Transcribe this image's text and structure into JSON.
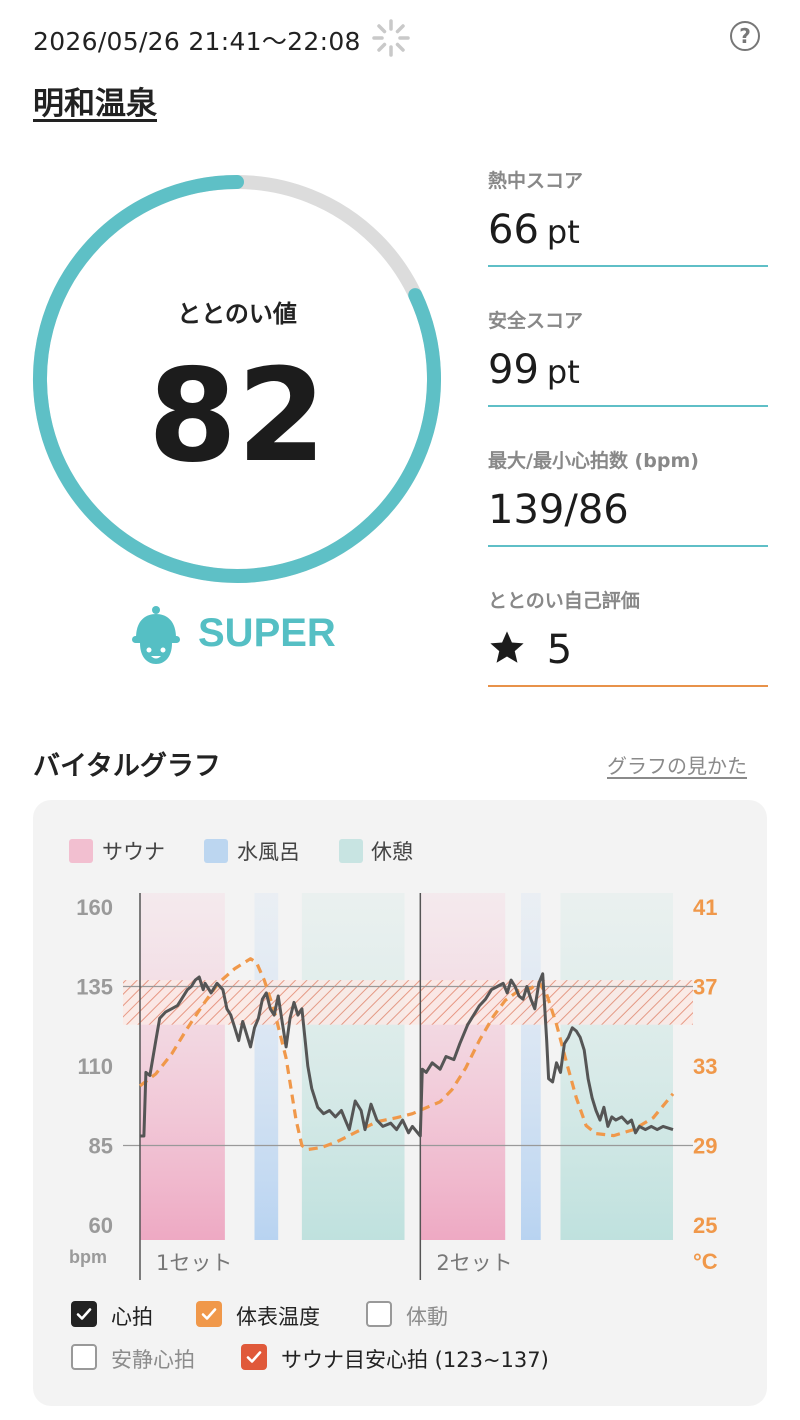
{
  "header": {
    "datetime": "2026/05/26 21:41～22:08",
    "place": "明和温泉",
    "help_symbol": "?",
    "spinner_icon": "loading-spinner-icon"
  },
  "gauge": {
    "label": "ととのい値",
    "value": "82",
    "fraction": 0.82,
    "color": "#5ec0c6",
    "track_color": "#dcdcdc",
    "level": "SUPER",
    "level_icon": "sauna-hat-mascot-icon"
  },
  "stats": [
    {
      "label": "熱中スコア",
      "value": "66",
      "unit": "pt"
    },
    {
      "label": "安全スコア",
      "value": "99",
      "unit": "pt"
    },
    {
      "label": "最大/最小心拍数 (bpm)",
      "value": "139/86",
      "unit": ""
    },
    {
      "label": "ととのい自己評価",
      "value": "5",
      "unit": "",
      "icon": "star-icon"
    }
  ],
  "vital": {
    "title": "バイタルグラフ",
    "howto_link": "グラフの見かた",
    "legend": [
      {
        "label": "サウナ",
        "color": "#f2bfd0"
      },
      {
        "label": "水風呂",
        "color": "#bcd6f0"
      },
      {
        "label": "休憩",
        "color": "#c8e4e2"
      }
    ],
    "left_axis_unit": "bpm",
    "right_axis_unit": "°C",
    "checkboxes": [
      {
        "label": "心拍",
        "checked": true,
        "color": "#222222"
      },
      {
        "label": "体表温度",
        "checked": true,
        "color": "#f0984a"
      },
      {
        "label": "体動",
        "checked": false,
        "color": "#888888"
      },
      {
        "label": "安静心拍",
        "checked": false,
        "color": "#888888"
      },
      {
        "label": "サウナ目安心拍 (123~137)",
        "checked": true,
        "color": "#e0593a"
      }
    ]
  },
  "chart_data": {
    "type": "line",
    "y_left_ticks": [
      "160",
      "135",
      "110",
      "85",
      "60"
    ],
    "y_left_range": [
      60,
      160
    ],
    "y_right_ticks": [
      "41",
      "37",
      "33",
      "29",
      "25"
    ],
    "y_right_range": [
      25,
      41
    ],
    "set_labels": [
      "1セット",
      "2セット"
    ],
    "target_band": [
      123,
      137
    ],
    "reference_line": 135,
    "baseline": 85,
    "time_range_min": [
      0,
      27
    ],
    "phases": [
      {
        "type": "サウナ",
        "start": 0.0,
        "end": 4.3
      },
      {
        "type": "水風呂",
        "start": 5.8,
        "end": 7.0
      },
      {
        "type": "休憩",
        "start": 8.2,
        "end": 13.4
      },
      {
        "type": "サウナ",
        "start": 14.2,
        "end": 18.5
      },
      {
        "type": "水風呂",
        "start": 19.3,
        "end": 20.3
      },
      {
        "type": "休憩",
        "start": 21.3,
        "end": 27.0
      }
    ],
    "series": [
      {
        "name": "心拍",
        "color": "#555555",
        "points": [
          [
            0,
            88
          ],
          [
            0.2,
            88
          ],
          [
            0.3,
            108
          ],
          [
            0.5,
            107
          ],
          [
            0.8,
            118
          ],
          [
            1.0,
            125
          ],
          [
            1.3,
            127
          ],
          [
            1.6,
            128
          ],
          [
            1.9,
            129
          ],
          [
            2.1,
            131
          ],
          [
            2.4,
            134
          ],
          [
            2.6,
            135
          ],
          [
            2.8,
            137
          ],
          [
            3.0,
            138
          ],
          [
            3.2,
            134
          ],
          [
            3.3,
            136
          ],
          [
            3.6,
            133
          ],
          [
            3.9,
            136
          ],
          [
            4.2,
            134
          ],
          [
            4.4,
            128
          ],
          [
            4.6,
            126
          ],
          [
            4.8,
            122
          ],
          [
            5.0,
            118
          ],
          [
            5.2,
            124
          ],
          [
            5.4,
            120
          ],
          [
            5.6,
            116
          ],
          [
            5.8,
            122
          ],
          [
            6.0,
            125
          ],
          [
            6.2,
            131
          ],
          [
            6.4,
            133
          ],
          [
            6.6,
            128
          ],
          [
            6.8,
            126
          ],
          [
            7.0,
            132
          ],
          [
            7.2,
            124
          ],
          [
            7.4,
            116
          ],
          [
            7.6,
            125
          ],
          [
            7.8,
            130
          ],
          [
            8.0,
            126
          ],
          [
            8.2,
            128
          ],
          [
            8.5,
            110
          ],
          [
            8.7,
            103
          ],
          [
            9.0,
            97
          ],
          [
            9.3,
            95
          ],
          [
            9.6,
            96
          ],
          [
            9.9,
            94
          ],
          [
            10.2,
            96
          ],
          [
            10.4,
            93
          ],
          [
            10.6,
            90
          ],
          [
            10.9,
            99
          ],
          [
            11.2,
            96
          ],
          [
            11.4,
            90
          ],
          [
            11.7,
            98
          ],
          [
            12.0,
            93
          ],
          [
            12.3,
            91
          ],
          [
            12.7,
            92
          ],
          [
            13.0,
            90
          ],
          [
            13.3,
            93
          ],
          [
            13.6,
            89
          ],
          [
            13.8,
            91
          ],
          [
            14.2,
            88
          ],
          [
            14.3,
            109
          ],
          [
            14.5,
            108
          ],
          [
            14.8,
            111
          ],
          [
            15.2,
            109
          ],
          [
            15.5,
            113
          ],
          [
            15.9,
            112
          ],
          [
            16.2,
            117
          ],
          [
            16.6,
            123
          ],
          [
            16.9,
            126
          ],
          [
            17.2,
            129
          ],
          [
            17.5,
            131
          ],
          [
            17.8,
            134
          ],
          [
            18.1,
            135
          ],
          [
            18.4,
            136
          ],
          [
            18.6,
            133
          ],
          [
            18.8,
            137
          ],
          [
            19.0,
            135
          ],
          [
            19.2,
            132
          ],
          [
            19.4,
            131
          ],
          [
            19.6,
            135
          ],
          [
            19.8,
            131
          ],
          [
            20.0,
            128
          ],
          [
            20.2,
            136
          ],
          [
            20.4,
            139
          ],
          [
            20.6,
            118
          ],
          [
            20.7,
            106
          ],
          [
            20.9,
            105
          ],
          [
            21.1,
            111
          ],
          [
            21.3,
            108
          ],
          [
            21.5,
            117
          ],
          [
            21.7,
            119
          ],
          [
            21.9,
            122
          ],
          [
            22.1,
            121
          ],
          [
            22.3,
            119
          ],
          [
            22.5,
            115
          ],
          [
            22.7,
            106
          ],
          [
            22.9,
            100
          ],
          [
            23.1,
            96
          ],
          [
            23.3,
            93
          ],
          [
            23.5,
            97
          ],
          [
            23.7,
            91
          ],
          [
            23.9,
            94
          ],
          [
            24.1,
            93
          ],
          [
            24.4,
            94
          ],
          [
            24.7,
            92
          ],
          [
            24.9,
            93
          ],
          [
            25.1,
            89
          ],
          [
            25.3,
            91
          ],
          [
            25.6,
            90
          ],
          [
            25.9,
            91
          ],
          [
            26.2,
            90
          ],
          [
            26.5,
            91
          ],
          [
            27.0,
            90
          ]
        ]
      },
      {
        "name": "体表温度",
        "color": "#f0984a",
        "points": [
          [
            0,
            32
          ],
          [
            0.8,
            32.6
          ],
          [
            1.6,
            33.6
          ],
          [
            2.4,
            34.9
          ],
          [
            3.2,
            36.1
          ],
          [
            4.0,
            37.2
          ],
          [
            4.8,
            37.9
          ],
          [
            5.6,
            38.4
          ],
          [
            5.9,
            38.2
          ],
          [
            6.3,
            37.3
          ],
          [
            6.8,
            35.8
          ],
          [
            7.4,
            33.4
          ],
          [
            7.9,
            30.3
          ],
          [
            8.2,
            29.0
          ],
          [
            8.5,
            28.8
          ],
          [
            9.2,
            28.9
          ],
          [
            10.0,
            29.2
          ],
          [
            11.0,
            29.7
          ],
          [
            12.0,
            30.2
          ],
          [
            13.0,
            30.4
          ],
          [
            13.8,
            30.6
          ],
          [
            14.5,
            30.9
          ],
          [
            15.2,
            31.2
          ],
          [
            15.8,
            31.8
          ],
          [
            16.5,
            32.9
          ],
          [
            17.2,
            34.3
          ],
          [
            17.9,
            35.5
          ],
          [
            18.5,
            36.3
          ],
          [
            19.2,
            36.8
          ],
          [
            19.8,
            36.9
          ],
          [
            20.2,
            37.2
          ],
          [
            20.6,
            36.6
          ],
          [
            21.1,
            35.1
          ],
          [
            21.6,
            33.2
          ],
          [
            22.1,
            31.4
          ],
          [
            22.6,
            30.0
          ],
          [
            23.1,
            29.6
          ],
          [
            24.0,
            29.5
          ],
          [
            25.0,
            29.8
          ],
          [
            26.0,
            30.4
          ],
          [
            27.0,
            31.6
          ]
        ]
      }
    ]
  }
}
